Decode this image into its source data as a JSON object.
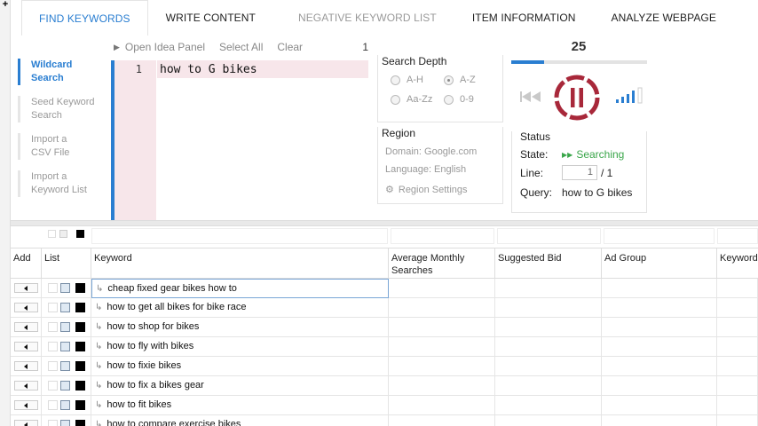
{
  "tabs": [
    {
      "label": "FIND KEYWORDS",
      "state": "active"
    },
    {
      "label": "WRITE CONTENT",
      "state": "normal"
    },
    {
      "label": "NEGATIVE KEYWORD LIST",
      "state": "disabled"
    },
    {
      "label": "ITEM INFORMATION",
      "state": "normal"
    },
    {
      "label": "ANALYZE WEBPAGE",
      "state": "normal"
    }
  ],
  "expand_glyph": "+",
  "toolbar": {
    "open_idea_panel": "Open Idea Panel",
    "select_all": "Select All",
    "clear": "Clear",
    "line_count": "1"
  },
  "side_nav": [
    {
      "label": "Wildcard Search",
      "active": true
    },
    {
      "label": "Seed Keyword Search",
      "active": false
    },
    {
      "label": "Import a CSV File",
      "active": false
    },
    {
      "label": "Import a Keyword List",
      "active": false
    }
  ],
  "editor": {
    "line_number": "1",
    "text": "how to G bikes"
  },
  "search_depth": {
    "title": "Search Depth",
    "options": [
      {
        "label": "A-H",
        "selected": false
      },
      {
        "label": "A-Z",
        "selected": true
      },
      {
        "label": "Aa-Zz",
        "selected": false
      },
      {
        "label": "0-9",
        "selected": false
      }
    ]
  },
  "region": {
    "title": "Region",
    "domain": "Domain: Google.com",
    "language": "Language: English",
    "settings": "Region Settings"
  },
  "progress": {
    "count": "25",
    "fraction": 0.24
  },
  "status": {
    "title": "Status",
    "state_label": "State:",
    "state_value": "Searching",
    "line_label": "Line:",
    "line_value": "1",
    "line_total": "/ 1",
    "query_label": "Query:",
    "query_value": "how to G bikes"
  },
  "grid": {
    "columns": [
      {
        "key": "add",
        "label": "Add"
      },
      {
        "key": "list",
        "label": "List"
      },
      {
        "key": "keyword",
        "label": "Keyword"
      },
      {
        "key": "searches",
        "label": "Average Monthly Searches"
      },
      {
        "key": "bid",
        "label": "Suggested Bid"
      },
      {
        "key": "adgroup",
        "label": "Ad Group"
      },
      {
        "key": "more",
        "label": "Keyword"
      }
    ],
    "rows": [
      "cheap fixed gear bikes how to",
      "how to get all bikes for bike race",
      "how to shop for bikes",
      "how to fly with bikes",
      "how to fixie bikes",
      "how to fix a bikes gear",
      "how to fit bikes",
      "how to compare exercise bikes"
    ]
  },
  "colors": {
    "accent": "#2a7ed1",
    "pause_ring": "#a8283a",
    "searching": "#3aa64a",
    "editor_highlight": "#f7e6ea"
  },
  "icons": {
    "skip": "skip-back-icon",
    "pause": "pause-icon",
    "signal": "signal-bars-icon",
    "play": "play-arrow-icon",
    "gear": "gear-icon"
  }
}
